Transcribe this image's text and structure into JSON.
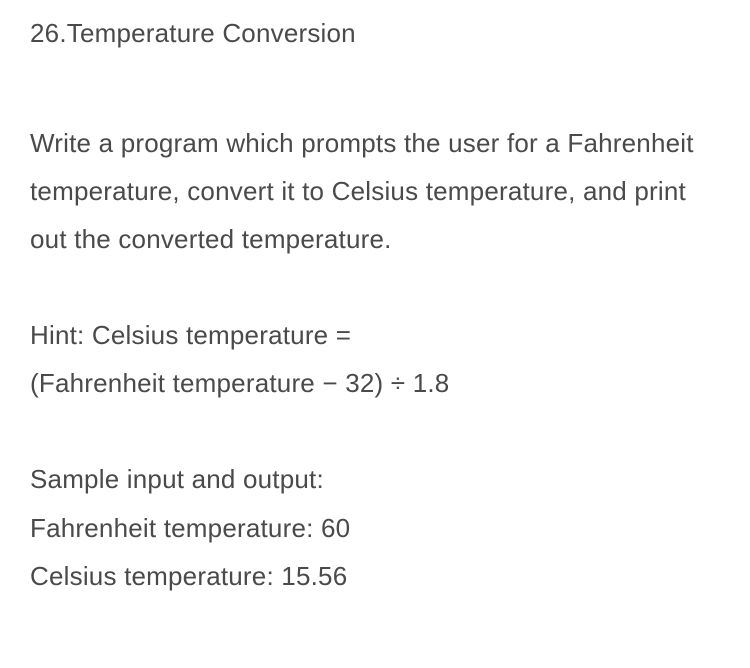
{
  "title": "26.Temperature Conversion",
  "description": "Write a program which prompts the user for a Fahrenheit temperature, convert it to Celsius temperature, and print out the converted temperature.",
  "hint": {
    "line1": "Hint: Celsius temperature =",
    "line2": "(Fahrenheit temperature − 32) ÷ 1.8"
  },
  "sample": {
    "heading": "Sample input and output:",
    "input_line": "Fahrenheit temperature: 60",
    "output_line": "Celsius temperature: 15.56"
  }
}
